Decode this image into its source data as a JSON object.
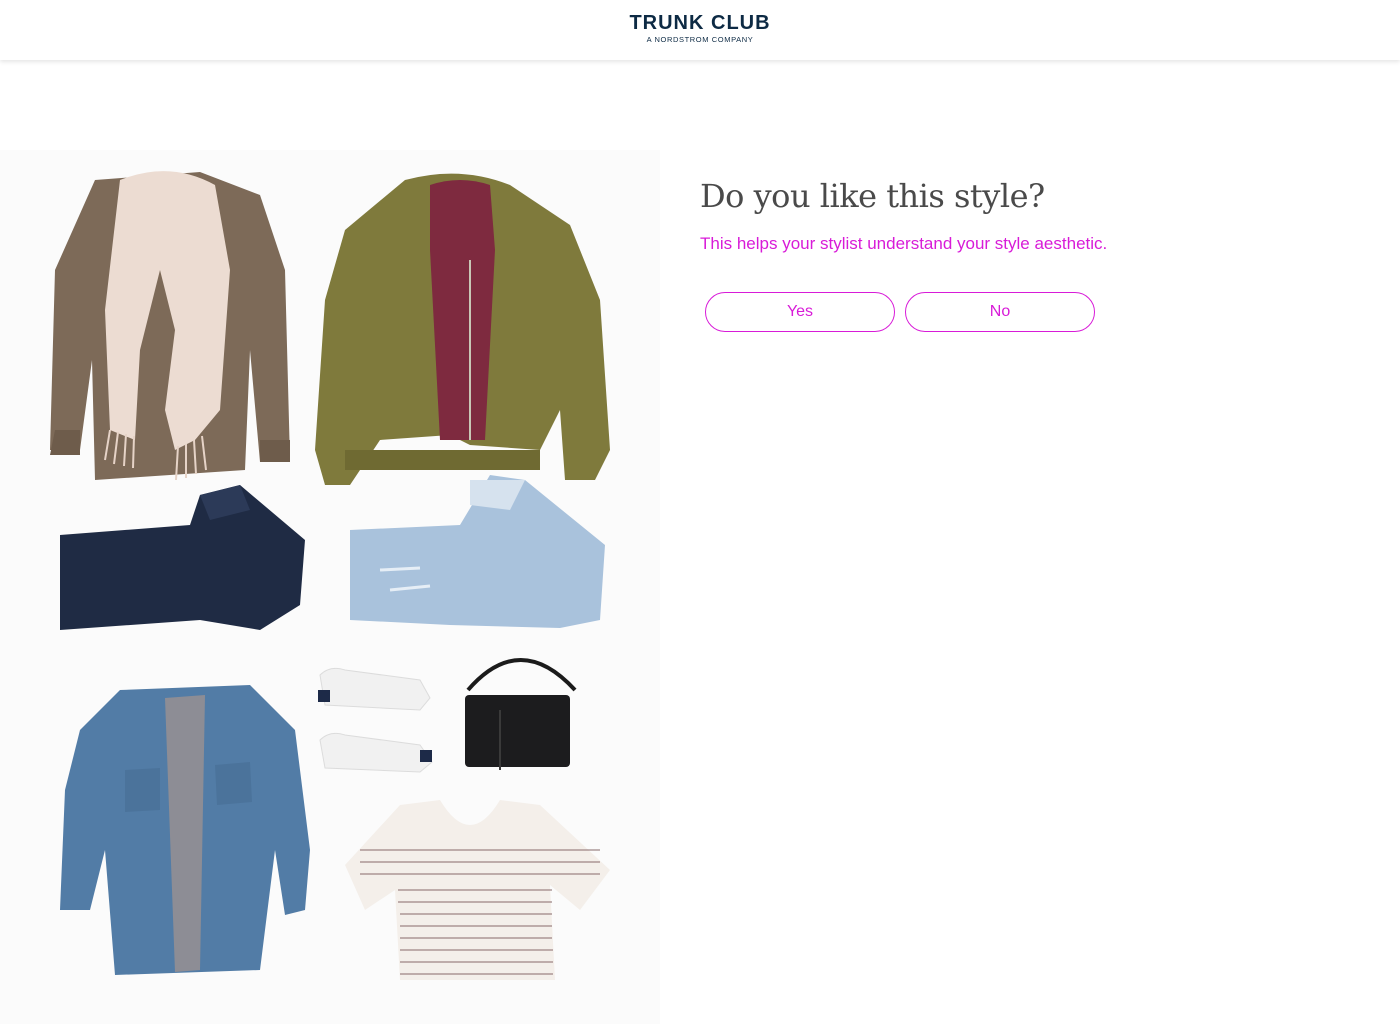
{
  "brand": {
    "name": "TRUNK CLUB",
    "tagline": "A NORDSTROM COMPANY",
    "color": "#0d2a44"
  },
  "question": {
    "title": "Do you like this style?",
    "subtitle": "This helps your stylist understand your style aesthetic."
  },
  "actions": {
    "yes_label": "Yes",
    "no_label": "No"
  },
  "style_image": {
    "items": [
      "scarf-and-blouse",
      "bomber-jacket",
      "navy-trousers",
      "distressed-jeans",
      "white-sneakers",
      "black-handbag",
      "denim-shirt",
      "striped-tee"
    ]
  },
  "colors": {
    "accent": "#d81bd8",
    "heading": "#4a4a4a"
  }
}
